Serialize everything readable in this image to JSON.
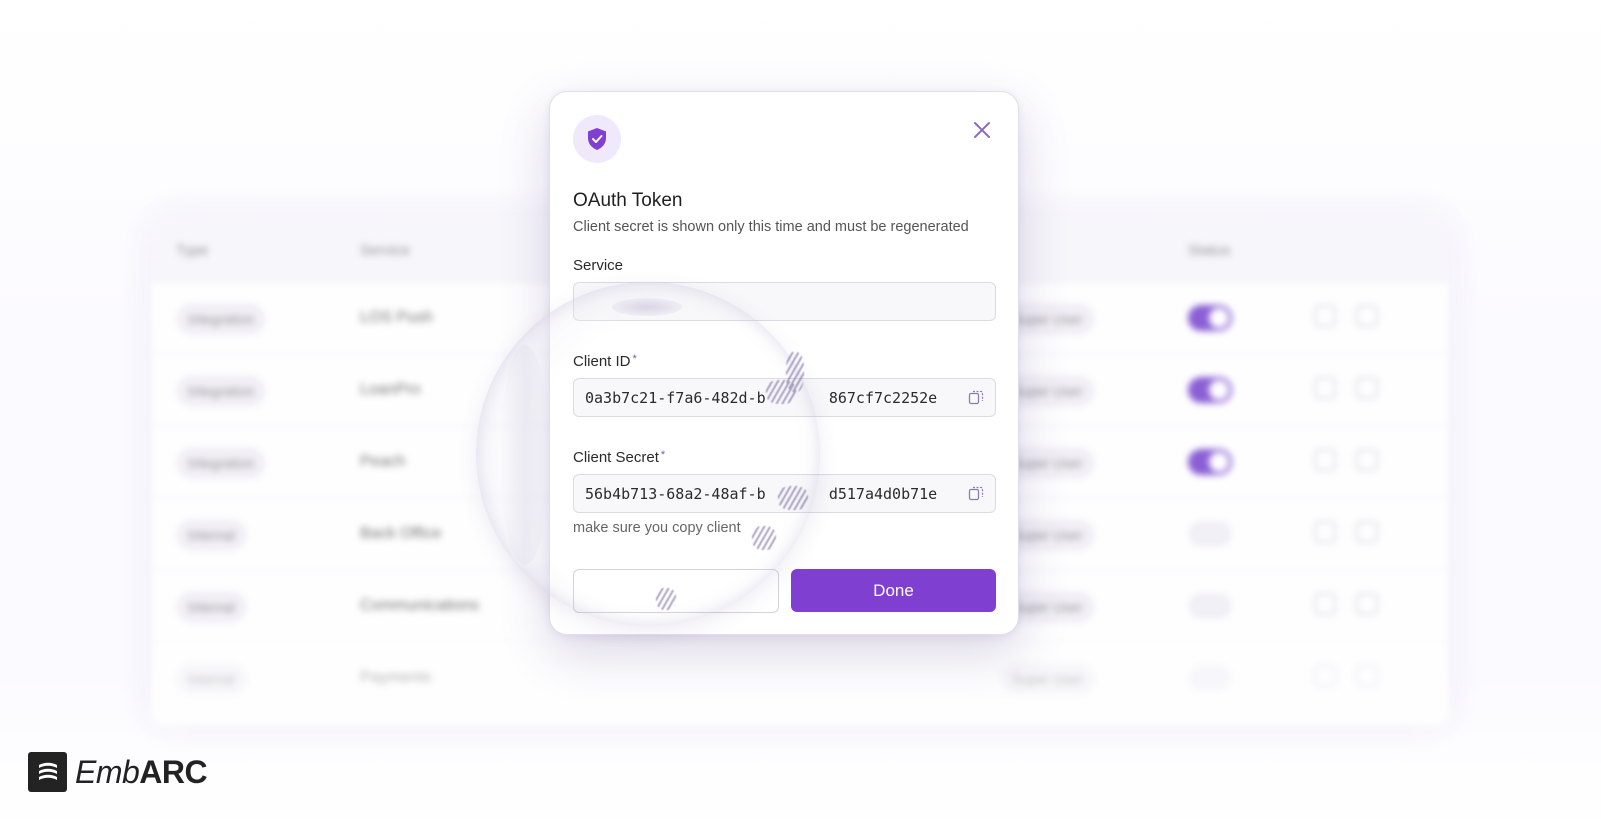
{
  "background_table": {
    "columns": [
      "Type",
      "Service",
      "",
      "",
      "",
      "Status"
    ],
    "rows": [
      {
        "type": "Integration",
        "service": "LOS Push",
        "role": "Super User",
        "status_on": true
      },
      {
        "type": "Integration",
        "service": "LoanPro",
        "role": "Super User",
        "status_on": true
      },
      {
        "type": "Integration",
        "service": "Peach",
        "role": "Super User",
        "status_on": true
      },
      {
        "type": "Internal",
        "service": "Back Office",
        "role": "Super User",
        "status_on": false
      },
      {
        "type": "Internal",
        "service": "Communications",
        "role": "Super User",
        "status_on": false
      },
      {
        "type": "Internal",
        "service": "Payments",
        "role": "Super User",
        "status_on": false
      }
    ]
  },
  "modal": {
    "icon": "shield-check-icon",
    "title": "OAuth Token",
    "subtitle": "Client secret is shown only this time and must be regenerated",
    "service_label": "Service",
    "service_value": "",
    "client_id_label": "Client ID",
    "client_id_value": "0a3b7c21-f7a6-482d-b       867cf7c2252e",
    "client_secret_label": "Client Secret",
    "client_secret_value": "56b4b713-68a2-48af-b       d517a4d0b71e",
    "required_mark": "*",
    "hint": "make sure you copy client",
    "secondary_label": "",
    "done_label": "Done"
  },
  "brand": {
    "name_light": "Emb",
    "name_bold": "ARC"
  },
  "colors": {
    "accent": "#7f3fd1",
    "icon_bg": "#efe9fb"
  }
}
